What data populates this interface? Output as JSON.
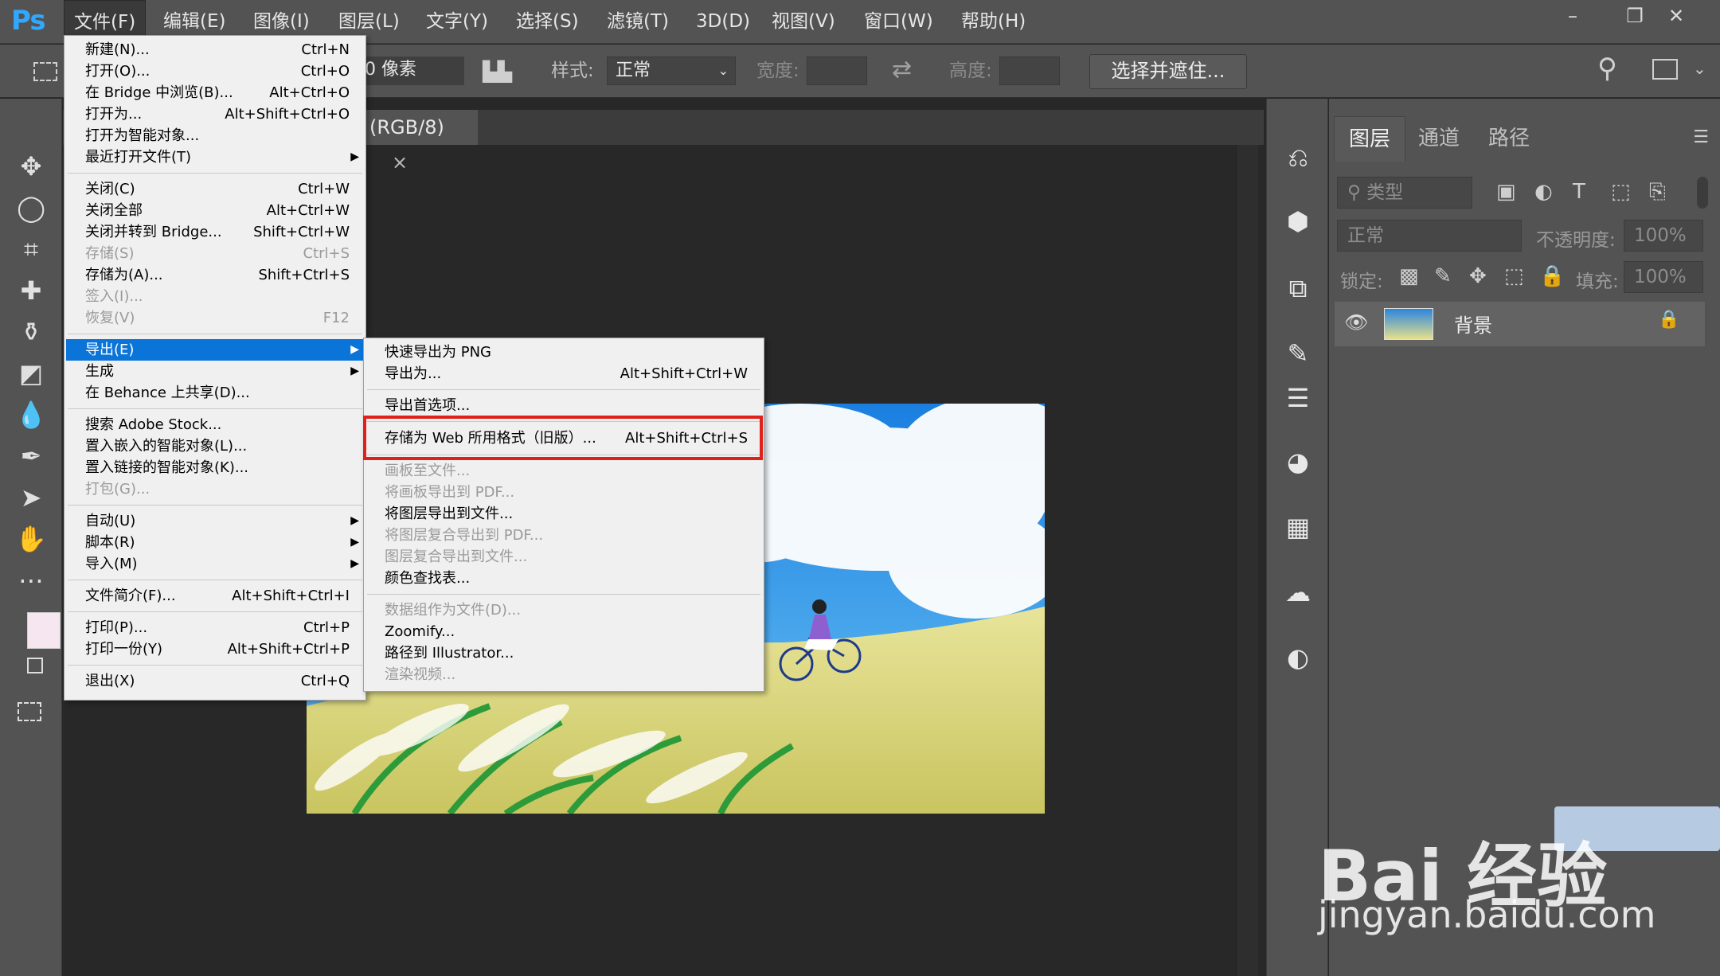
{
  "app": {
    "logo": "Ps"
  },
  "menubar": {
    "items": [
      "文件(F)",
      "编辑(E)",
      "图像(I)",
      "图层(L)",
      "文字(Y)",
      "选择(S)",
      "滤镜(T)",
      "3D(D)",
      "视图(V)",
      "窗口(W)",
      "帮助(H)"
    ],
    "window_controls": [
      "–",
      "❐",
      "✕"
    ]
  },
  "options_bar": {
    "feather_value": "0 像素",
    "style_label": "样式:",
    "style_value": "正常",
    "width_label": "宽度:",
    "height_label": "高度:",
    "select_mask_button": "选择并遮住...",
    "collapse_left": "«",
    "collapse_right": "»"
  },
  "document": {
    "tab_title": "(RGB/8)",
    "tab_close": "×"
  },
  "file_menu": {
    "items": [
      {
        "label": "新建(N)...",
        "shortcut": "Ctrl+N"
      },
      {
        "label": "打开(O)...",
        "shortcut": "Ctrl+O"
      },
      {
        "label": "在 Bridge 中浏览(B)...",
        "shortcut": "Alt+Ctrl+O"
      },
      {
        "label": "打开为...",
        "shortcut": "Alt+Shift+Ctrl+O"
      },
      {
        "label": "打开为智能对象...",
        "shortcut": ""
      },
      {
        "label": "最近打开文件(T)",
        "shortcut": ""
      },
      {
        "label": "关闭(C)",
        "shortcut": "Ctrl+W"
      },
      {
        "label": "关闭全部",
        "shortcut": "Alt+Ctrl+W"
      },
      {
        "label": "关闭并转到 Bridge...",
        "shortcut": "Shift+Ctrl+W"
      },
      {
        "label": "存储(S)",
        "shortcut": "Ctrl+S"
      },
      {
        "label": "存储为(A)...",
        "shortcut": "Shift+Ctrl+S"
      },
      {
        "label": "签入(I)...",
        "shortcut": ""
      },
      {
        "label": "恢复(V)",
        "shortcut": "F12"
      },
      {
        "label": "导出(E)",
        "shortcut": ""
      },
      {
        "label": "生成",
        "shortcut": ""
      },
      {
        "label": "在 Behance 上共享(D)...",
        "shortcut": ""
      },
      {
        "label": "搜索 Adobe Stock...",
        "shortcut": ""
      },
      {
        "label": "置入嵌入的智能对象(L)...",
        "shortcut": ""
      },
      {
        "label": "置入链接的智能对象(K)...",
        "shortcut": ""
      },
      {
        "label": "打包(G)...",
        "shortcut": ""
      },
      {
        "label": "自动(U)",
        "shortcut": ""
      },
      {
        "label": "脚本(R)",
        "shortcut": ""
      },
      {
        "label": "导入(M)",
        "shortcut": ""
      },
      {
        "label": "文件简介(F)...",
        "shortcut": "Alt+Shift+Ctrl+I"
      },
      {
        "label": "打印(P)...",
        "shortcut": "Ctrl+P"
      },
      {
        "label": "打印一份(Y)",
        "shortcut": "Alt+Shift+Ctrl+P"
      },
      {
        "label": "退出(X)",
        "shortcut": "Ctrl+Q"
      }
    ],
    "submenu_arrow": "▶"
  },
  "export_submenu": {
    "items": [
      {
        "label": "快速导出为 PNG",
        "shortcut": ""
      },
      {
        "label": "导出为...",
        "shortcut": "Alt+Shift+Ctrl+W"
      },
      {
        "label": "导出首选项...",
        "shortcut": ""
      },
      {
        "label": "存储为 Web 所用格式（旧版）...",
        "shortcut": "Alt+Shift+Ctrl+S"
      },
      {
        "label": "画板至文件...",
        "shortcut": ""
      },
      {
        "label": "将画板导出到 PDF...",
        "shortcut": ""
      },
      {
        "label": "将图层导出到文件...",
        "shortcut": ""
      },
      {
        "label": "将图层复合导出到 PDF...",
        "shortcut": ""
      },
      {
        "label": "图层复合导出到文件...",
        "shortcut": ""
      },
      {
        "label": "颜色查找表...",
        "shortcut": ""
      },
      {
        "label": "数据组作为文件(D)...",
        "shortcut": ""
      },
      {
        "label": "Zoomify...",
        "shortcut": ""
      },
      {
        "label": "路径到 Illustrator...",
        "shortcut": ""
      },
      {
        "label": "渲染视频...",
        "shortcut": ""
      }
    ]
  },
  "layers_panel": {
    "tabs": [
      "图层",
      "通道",
      "路径"
    ],
    "filter_kind": "类型",
    "blend_mode": "正常",
    "opacity_label": "不透明度:",
    "opacity_value": "100%",
    "lock_label": "锁定:",
    "fill_label": "填充:",
    "fill_value": "100%",
    "layer_name": "背景",
    "menu_icon": "☰"
  },
  "watermark": {
    "brand": "Bai 经验",
    "url": "jingyan.baidu.com"
  },
  "colors": {
    "accent_highlight": "#0a74d8",
    "callout_red": "#e0211a",
    "ps_blue": "#31a8ff"
  }
}
